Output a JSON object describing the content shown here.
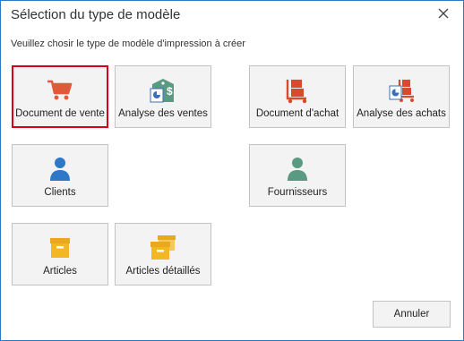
{
  "window": {
    "title": "Sélection du type de modèle",
    "instruction": "Veuillez chosir le type de modèle d'impression à créer"
  },
  "tiles": [
    {
      "label": "Document de vente",
      "icon": "shopping-cart-icon",
      "selected": true
    },
    {
      "label": "Analyse des ventes",
      "icon": "price-tag-chart-icon",
      "selected": false
    },
    {
      "label": "Document d'achat",
      "icon": "hand-truck-icon",
      "selected": false
    },
    {
      "label": "Analyse des achats",
      "icon": "hand-truck-chart-icon",
      "selected": false
    },
    {
      "label": "Clients",
      "icon": "customer-person-icon",
      "selected": false
    },
    {
      "label": "Fournisseurs",
      "icon": "supplier-person-icon",
      "selected": false
    },
    {
      "label": "Articles",
      "icon": "box-icon",
      "selected": false
    },
    {
      "label": "Articles détaillés",
      "icon": "stacked-boxes-icon",
      "selected": false
    }
  ],
  "buttons": {
    "cancel": "Annuler"
  },
  "colors": {
    "sales": "#e05a3a",
    "purchase": "#d64b2f",
    "customer": "#2f78c8",
    "supplier": "#5a9a82",
    "articles": "#f2b824",
    "selection": "#d9001b",
    "window_border": "#2b78c6"
  }
}
